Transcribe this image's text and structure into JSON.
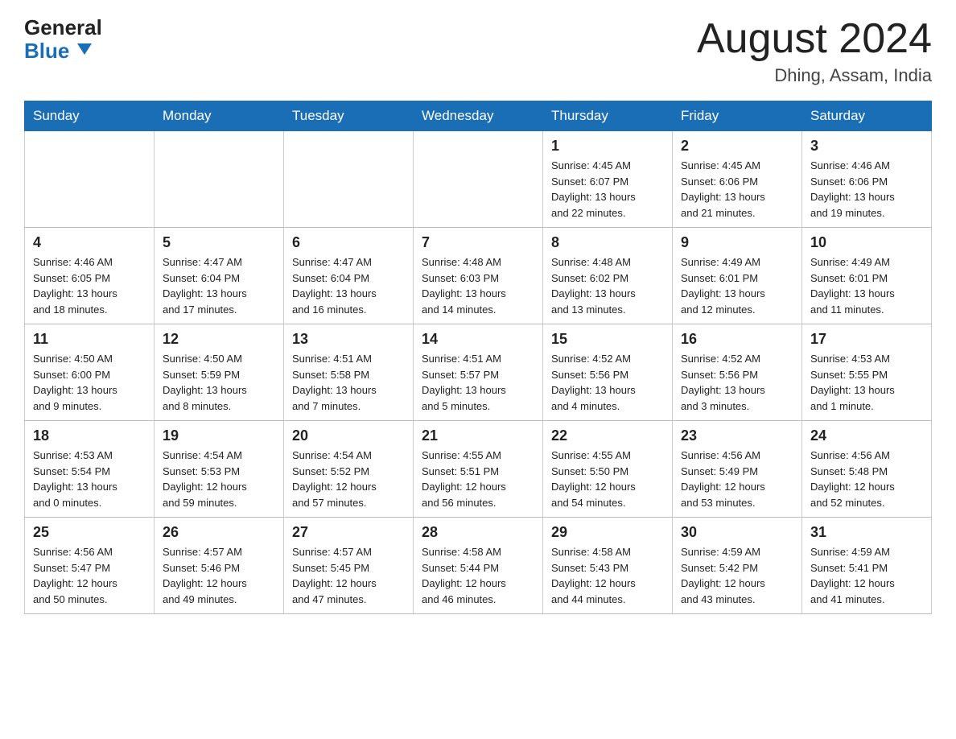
{
  "header": {
    "logo_line1": "General",
    "logo_line2": "Blue",
    "title": "August 2024",
    "location": "Dhing, Assam, India"
  },
  "days_of_week": [
    "Sunday",
    "Monday",
    "Tuesday",
    "Wednesday",
    "Thursday",
    "Friday",
    "Saturday"
  ],
  "weeks": [
    [
      {
        "day": "",
        "info": ""
      },
      {
        "day": "",
        "info": ""
      },
      {
        "day": "",
        "info": ""
      },
      {
        "day": "",
        "info": ""
      },
      {
        "day": "1",
        "info": "Sunrise: 4:45 AM\nSunset: 6:07 PM\nDaylight: 13 hours\nand 22 minutes."
      },
      {
        "day": "2",
        "info": "Sunrise: 4:45 AM\nSunset: 6:06 PM\nDaylight: 13 hours\nand 21 minutes."
      },
      {
        "day": "3",
        "info": "Sunrise: 4:46 AM\nSunset: 6:06 PM\nDaylight: 13 hours\nand 19 minutes."
      }
    ],
    [
      {
        "day": "4",
        "info": "Sunrise: 4:46 AM\nSunset: 6:05 PM\nDaylight: 13 hours\nand 18 minutes."
      },
      {
        "day": "5",
        "info": "Sunrise: 4:47 AM\nSunset: 6:04 PM\nDaylight: 13 hours\nand 17 minutes."
      },
      {
        "day": "6",
        "info": "Sunrise: 4:47 AM\nSunset: 6:04 PM\nDaylight: 13 hours\nand 16 minutes."
      },
      {
        "day": "7",
        "info": "Sunrise: 4:48 AM\nSunset: 6:03 PM\nDaylight: 13 hours\nand 14 minutes."
      },
      {
        "day": "8",
        "info": "Sunrise: 4:48 AM\nSunset: 6:02 PM\nDaylight: 13 hours\nand 13 minutes."
      },
      {
        "day": "9",
        "info": "Sunrise: 4:49 AM\nSunset: 6:01 PM\nDaylight: 13 hours\nand 12 minutes."
      },
      {
        "day": "10",
        "info": "Sunrise: 4:49 AM\nSunset: 6:01 PM\nDaylight: 13 hours\nand 11 minutes."
      }
    ],
    [
      {
        "day": "11",
        "info": "Sunrise: 4:50 AM\nSunset: 6:00 PM\nDaylight: 13 hours\nand 9 minutes."
      },
      {
        "day": "12",
        "info": "Sunrise: 4:50 AM\nSunset: 5:59 PM\nDaylight: 13 hours\nand 8 minutes."
      },
      {
        "day": "13",
        "info": "Sunrise: 4:51 AM\nSunset: 5:58 PM\nDaylight: 13 hours\nand 7 minutes."
      },
      {
        "day": "14",
        "info": "Sunrise: 4:51 AM\nSunset: 5:57 PM\nDaylight: 13 hours\nand 5 minutes."
      },
      {
        "day": "15",
        "info": "Sunrise: 4:52 AM\nSunset: 5:56 PM\nDaylight: 13 hours\nand 4 minutes."
      },
      {
        "day": "16",
        "info": "Sunrise: 4:52 AM\nSunset: 5:56 PM\nDaylight: 13 hours\nand 3 minutes."
      },
      {
        "day": "17",
        "info": "Sunrise: 4:53 AM\nSunset: 5:55 PM\nDaylight: 13 hours\nand 1 minute."
      }
    ],
    [
      {
        "day": "18",
        "info": "Sunrise: 4:53 AM\nSunset: 5:54 PM\nDaylight: 13 hours\nand 0 minutes."
      },
      {
        "day": "19",
        "info": "Sunrise: 4:54 AM\nSunset: 5:53 PM\nDaylight: 12 hours\nand 59 minutes."
      },
      {
        "day": "20",
        "info": "Sunrise: 4:54 AM\nSunset: 5:52 PM\nDaylight: 12 hours\nand 57 minutes."
      },
      {
        "day": "21",
        "info": "Sunrise: 4:55 AM\nSunset: 5:51 PM\nDaylight: 12 hours\nand 56 minutes."
      },
      {
        "day": "22",
        "info": "Sunrise: 4:55 AM\nSunset: 5:50 PM\nDaylight: 12 hours\nand 54 minutes."
      },
      {
        "day": "23",
        "info": "Sunrise: 4:56 AM\nSunset: 5:49 PM\nDaylight: 12 hours\nand 53 minutes."
      },
      {
        "day": "24",
        "info": "Sunrise: 4:56 AM\nSunset: 5:48 PM\nDaylight: 12 hours\nand 52 minutes."
      }
    ],
    [
      {
        "day": "25",
        "info": "Sunrise: 4:56 AM\nSunset: 5:47 PM\nDaylight: 12 hours\nand 50 minutes."
      },
      {
        "day": "26",
        "info": "Sunrise: 4:57 AM\nSunset: 5:46 PM\nDaylight: 12 hours\nand 49 minutes."
      },
      {
        "day": "27",
        "info": "Sunrise: 4:57 AM\nSunset: 5:45 PM\nDaylight: 12 hours\nand 47 minutes."
      },
      {
        "day": "28",
        "info": "Sunrise: 4:58 AM\nSunset: 5:44 PM\nDaylight: 12 hours\nand 46 minutes."
      },
      {
        "day": "29",
        "info": "Sunrise: 4:58 AM\nSunset: 5:43 PM\nDaylight: 12 hours\nand 44 minutes."
      },
      {
        "day": "30",
        "info": "Sunrise: 4:59 AM\nSunset: 5:42 PM\nDaylight: 12 hours\nand 43 minutes."
      },
      {
        "day": "31",
        "info": "Sunrise: 4:59 AM\nSunset: 5:41 PM\nDaylight: 12 hours\nand 41 minutes."
      }
    ]
  ]
}
